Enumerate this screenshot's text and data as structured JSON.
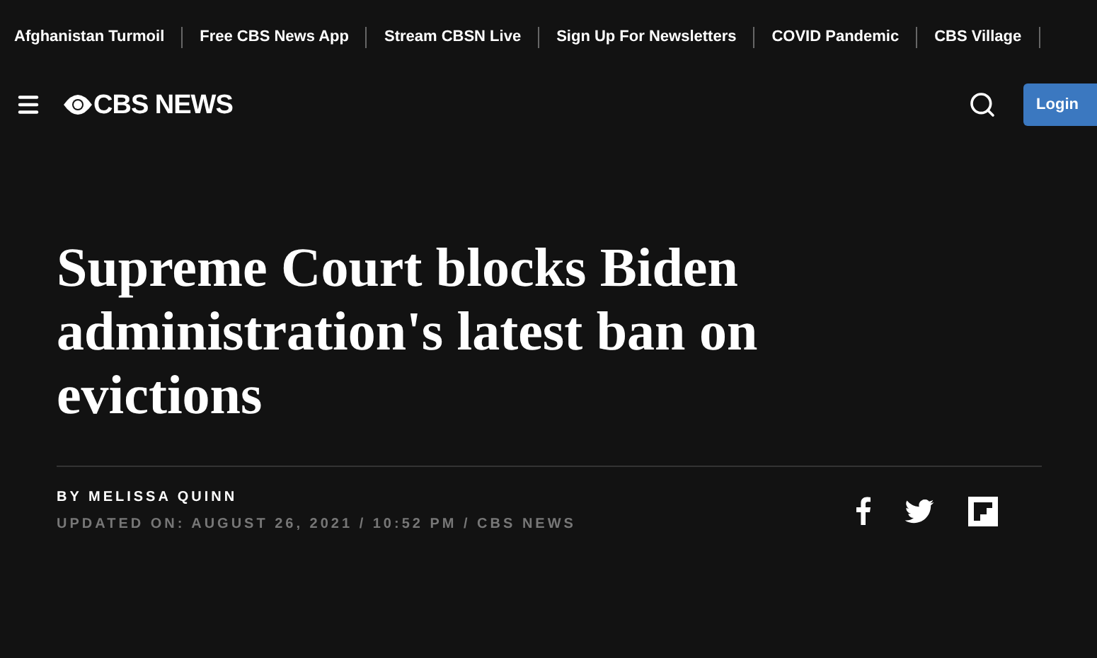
{
  "top_links": [
    "Afghanistan Turmoil",
    "Free CBS News App",
    "Stream CBSN Live",
    "Sign Up For Newsletters",
    "COVID Pandemic",
    "CBS Village"
  ],
  "header": {
    "logo": "CBS NEWS",
    "login": "Login"
  },
  "article": {
    "headline": "Supreme Court blocks Biden administration's latest ban on evictions",
    "byline": "BY MELISSA QUINN",
    "updated": "UPDATED ON: AUGUST 26, 2021 / 10:52 PM / CBS NEWS"
  }
}
